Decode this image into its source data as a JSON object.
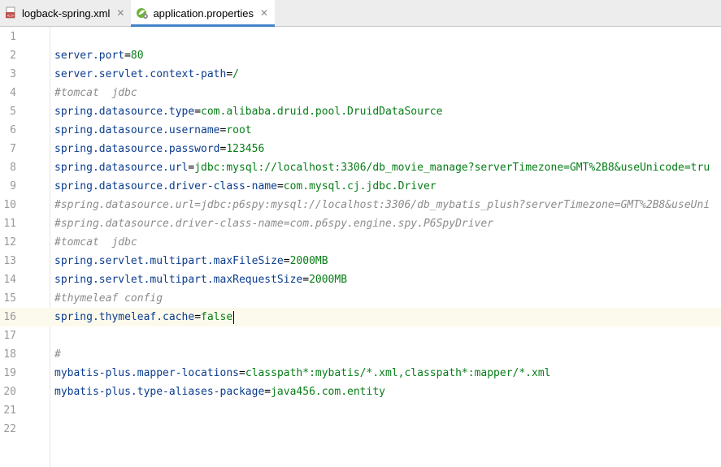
{
  "tabs": [
    {
      "label": "logback-spring.xml",
      "icon": "xml-file-icon",
      "active": false,
      "close": "✕"
    },
    {
      "label": "application.properties",
      "icon": "spring-properties-icon",
      "active": true,
      "close": "✕"
    }
  ],
  "lines": [
    {
      "n": "1",
      "key": "",
      "eq": "",
      "val": "",
      "comment": ""
    },
    {
      "n": "2",
      "key": "server.port",
      "eq": "=",
      "val": "80",
      "comment": ""
    },
    {
      "n": "3",
      "key": "server.servlet.context-path",
      "eq": "=",
      "val": "/",
      "comment": ""
    },
    {
      "n": "4",
      "key": "",
      "eq": "",
      "val": "",
      "comment": "#tomcat  jdbc"
    },
    {
      "n": "5",
      "key": "spring.datasource.type",
      "eq": "=",
      "val": "com.alibaba.druid.pool.DruidDataSource",
      "comment": ""
    },
    {
      "n": "6",
      "key": "spring.datasource.username",
      "eq": "=",
      "val": "root",
      "comment": ""
    },
    {
      "n": "7",
      "key": "spring.datasource.password",
      "eq": "=",
      "val": "123456",
      "comment": ""
    },
    {
      "n": "8",
      "key": "spring.datasource.url",
      "eq": "=",
      "val": "jdbc:mysql://localhost:3306/db_movie_manage?serverTimezone=GMT%2B8&useUnicode=tru",
      "comment": ""
    },
    {
      "n": "9",
      "key": "spring.datasource.driver-class-name",
      "eq": "=",
      "val": "com.mysql.cj.jdbc.Driver",
      "comment": ""
    },
    {
      "n": "10",
      "key": "",
      "eq": "",
      "val": "",
      "comment": "#spring.datasource.url=jdbc:p6spy:mysql://localhost:3306/db_mybatis_plush?serverTimezone=GMT%2B8&useUni"
    },
    {
      "n": "11",
      "key": "",
      "eq": "",
      "val": "",
      "comment": "#spring.datasource.driver-class-name=com.p6spy.engine.spy.P6SpyDriver"
    },
    {
      "n": "12",
      "key": "",
      "eq": "",
      "val": "",
      "comment": "#tomcat  jdbc"
    },
    {
      "n": "13",
      "key": "spring.servlet.multipart.maxFileSize",
      "eq": "=",
      "val": "2000MB",
      "comment": ""
    },
    {
      "n": "14",
      "key": "spring.servlet.multipart.maxRequestSize",
      "eq": "=",
      "val": "2000MB",
      "comment": ""
    },
    {
      "n": "15",
      "key": "",
      "eq": "",
      "val": "",
      "comment": "#thymeleaf config"
    },
    {
      "n": "16",
      "key": "spring.thymeleaf.cache",
      "eq": "=",
      "val": "false",
      "comment": "",
      "current": true
    },
    {
      "n": "17",
      "key": "",
      "eq": "",
      "val": "",
      "comment": ""
    },
    {
      "n": "18",
      "key": "",
      "eq": "",
      "val": "",
      "comment": "#"
    },
    {
      "n": "19",
      "key": "mybatis-plus.mapper-locations",
      "eq": "=",
      "val": "classpath*:mybatis/*.xml,classpath*:mapper/*.xml",
      "comment": ""
    },
    {
      "n": "20",
      "key": "mybatis-plus.type-aliases-package",
      "eq": "=",
      "val": "java456.com.entity",
      "comment": ""
    },
    {
      "n": "21",
      "key": "",
      "eq": "",
      "val": "",
      "comment": ""
    },
    {
      "n": "22",
      "key": "",
      "eq": "",
      "val": "",
      "comment": ""
    }
  ],
  "colors": {
    "key": "#0b3c8f",
    "value": "#067d17",
    "comment": "#8c8c8c",
    "current_line": "#fcfaed",
    "tab_underline": "#4083c9"
  }
}
